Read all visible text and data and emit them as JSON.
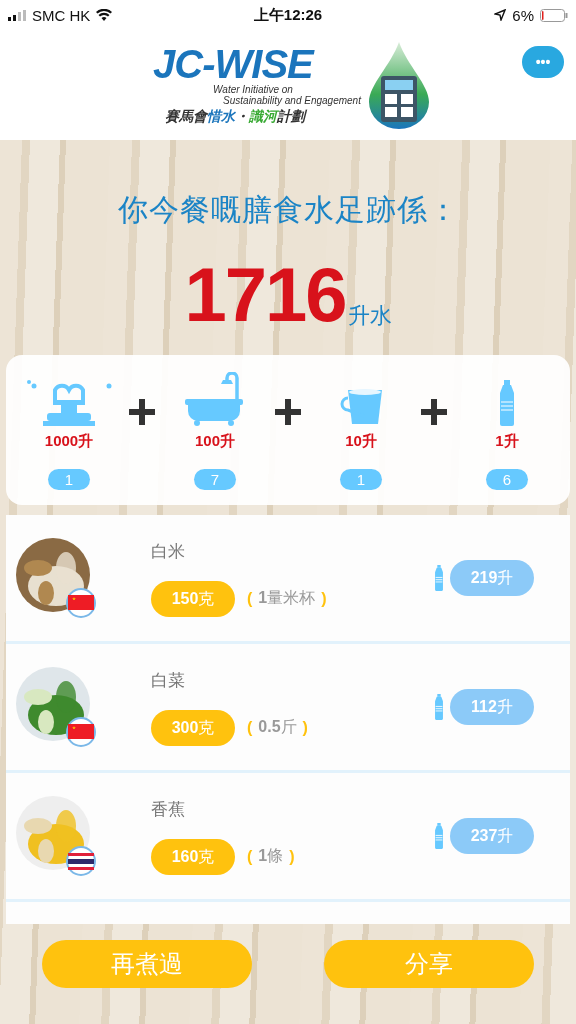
{
  "status_bar": {
    "carrier": "SMC HK",
    "time": "上午12:26",
    "battery": "6%"
  },
  "header": {
    "logo": {
      "title": "JC-WISE",
      "subtitle_1": "Water Initiative on",
      "subtitle_2": "Sustainability and Engagement",
      "tagline": [
        {
          "text": "賽馬會",
          "color": "#333333"
        },
        {
          "text": "惜水",
          "color": "#1b75bc"
        },
        {
          "text": "・",
          "color": "#333333"
        },
        {
          "text": "識河",
          "color": "#3aaa35"
        },
        {
          "text": "計劃",
          "color": "#333333"
        }
      ]
    },
    "menu_label": "•••"
  },
  "result": {
    "heading": "你今餐嘅膳食水足跡係：",
    "total": "1716",
    "unit": "升水"
  },
  "summary": [
    {
      "kind": "fountain",
      "value": "1000升",
      "count": "1"
    },
    {
      "kind": "bathtub",
      "value": "100升",
      "count": "7"
    },
    {
      "kind": "bucket",
      "value": "10升",
      "count": "1"
    },
    {
      "kind": "bottle",
      "value": "1升",
      "count": "6"
    }
  ],
  "foods": [
    {
      "name": "白米",
      "flag": {
        "kind": "cn"
      },
      "amount": "**150**克",
      "portion": [
        "(",
        "**1**量米杯",
        ")"
      ],
      "water": "**219**升"
    },
    {
      "name": "白菜",
      "flag": {
        "kind": "cn"
      },
      "amount": "**300**克",
      "portion": [
        "(",
        "**0.5**斤",
        ")"
      ],
      "water": "**112**升"
    },
    {
      "name": "香蕉",
      "flag": {
        "kind": "th"
      },
      "amount": "**160**克",
      "portion": [
        "(",
        "**1**條",
        ")"
      ],
      "water": "**237**升"
    }
  ],
  "buttons": [
    "再煮過",
    "分享"
  ]
}
